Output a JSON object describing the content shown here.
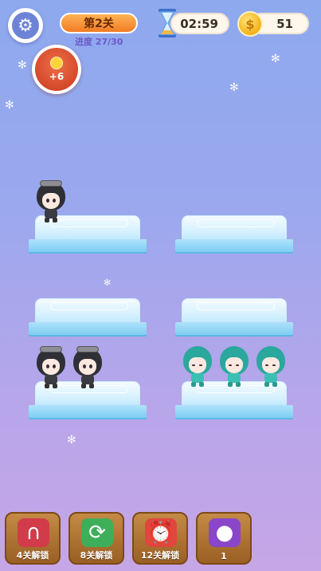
{
  "header": {
    "level_label": "第2关",
    "progress_text": "进度 27/30",
    "timer": "02:59",
    "coins": "51",
    "coin_symbol": "$",
    "bonus": "+6"
  },
  "toolbar": {
    "tools": [
      {
        "icon": "magnet-icon",
        "label": "4关解锁"
      },
      {
        "icon": "shuffle-icon",
        "label": "8关解锁"
      },
      {
        "icon": "alarm-clock-icon",
        "label": "12关解锁"
      },
      {
        "icon": "locked-tool-icon",
        "label": "1"
      }
    ]
  },
  "board": {
    "platforms": [
      {
        "name": "platform-1",
        "characters": [
          "dark"
        ]
      },
      {
        "name": "platform-2",
        "characters": []
      },
      {
        "name": "platform-3",
        "characters": []
      },
      {
        "name": "platform-4",
        "characters": []
      },
      {
        "name": "platform-5",
        "characters": [
          "dark",
          "dark"
        ]
      },
      {
        "name": "platform-6",
        "characters": [
          "teal",
          "teal",
          "teal"
        ]
      }
    ]
  },
  "colors": {
    "background_top": "#8ea9ee",
    "background_bottom": "#c6a6e6",
    "level_pill": "#f07c24",
    "toolbar_button": "#9a5f24"
  }
}
